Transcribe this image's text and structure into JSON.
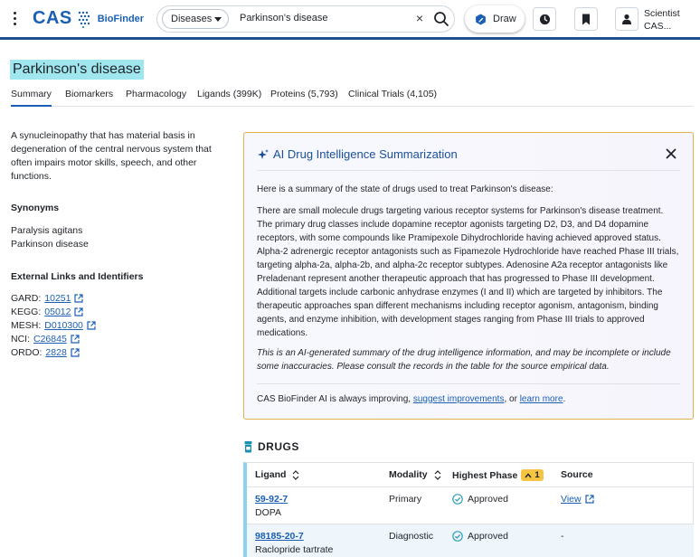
{
  "header": {
    "logo_text": "CAS",
    "product_name": "BioFinder",
    "search_type": "Diseases",
    "search_query": "Parkinson's disease",
    "draw_label": "Draw",
    "user_name_line1": "Scientist",
    "user_name_line2": "CAS..."
  },
  "page": {
    "title": "Parkinson's disease",
    "tabs": [
      {
        "label": "Summary"
      },
      {
        "label": "Biomarkers"
      },
      {
        "label": "Pharmacology"
      },
      {
        "label": "Ligands (399K)"
      },
      {
        "label": "Proteins (5,793)"
      },
      {
        "label": "Clinical Trials (4,105)"
      }
    ]
  },
  "left": {
    "description": "A synucleinopathy that has material basis in degeneration of the central nervous system that often impairs motor skills, speech, and other functions.",
    "synonyms_heading": "Synonyms",
    "synonyms": [
      "Paralysis agitans",
      "Parkinson disease"
    ],
    "ext_heading": "External Links and Identifiers",
    "ext_links": [
      {
        "label": "GARD:",
        "id": "10251"
      },
      {
        "label": "KEGG:",
        "id": "05012"
      },
      {
        "label": "MESH:",
        "id": "D010300"
      },
      {
        "label": "NCI:",
        "id": "C26845"
      },
      {
        "label": "ORDO:",
        "id": "2828"
      }
    ]
  },
  "ai": {
    "title": "AI Drug Intelligence Summarization",
    "intro": "Here is a summary of the state of drugs used to treat Parkinson's disease:",
    "body": "There are small molecule drugs targeting various receptor systems for Parkinson's disease treatment. The primary drug classes include dopamine receptor agonists targeting D2, D3, and D4 dopamine receptors, with some compounds like Pramipexole Dihydrochloride having achieved approved status. Alpha-2 adrenergic receptor antagonists such as Fipamezole Hydrochloride have reached Phase III trials, targeting alpha-2a, alpha-2b, and alpha-2c receptor subtypes. Adenosine A2a receptor antagonists like Preladenant represent another therapeutic approach that has progressed to Phase III development. Additional targets include carbonic anhydrase enzymes (I and II) which are targeted by inhibitors. The therapeutic approaches span different mechanisms including receptor agonism, antagonism, binding agents, and enzyme inhibition, with development stages ranging from Phase III trials to approved medications.",
    "disclaimer": "This is an AI-generated summary of the drug intelligence information, and may be incomplete or include some inaccuracies. Please consult the records in the table for the source empirical data.",
    "footer_prefix": "CAS BioFinder AI is always improving,",
    "footer_link1": "suggest improvements",
    "footer_mid": ", or",
    "footer_link2": "learn more",
    "footer_suffix": "."
  },
  "drugs": {
    "heading": "DRUGS",
    "columns": {
      "ligand": "Ligand",
      "modality": "Modality",
      "phase": "Highest Phase",
      "phase_badge": "1",
      "source": "Source"
    },
    "rows": [
      {
        "id": "59-92-7",
        "name": "DOPA",
        "modality": "Primary",
        "phase": "Approved",
        "source": "View"
      },
      {
        "id": "98185-20-7",
        "name": "Raclopride tartrate",
        "modality": "Diagnostic",
        "phase": "Approved",
        "source": "-"
      }
    ]
  },
  "colors": {
    "brand": "#1a5fb4",
    "title_highlight": "#9fe6ee",
    "ai_border": "#e0b24a",
    "badge": "#f6c443",
    "approved": "#2f9fb8"
  }
}
